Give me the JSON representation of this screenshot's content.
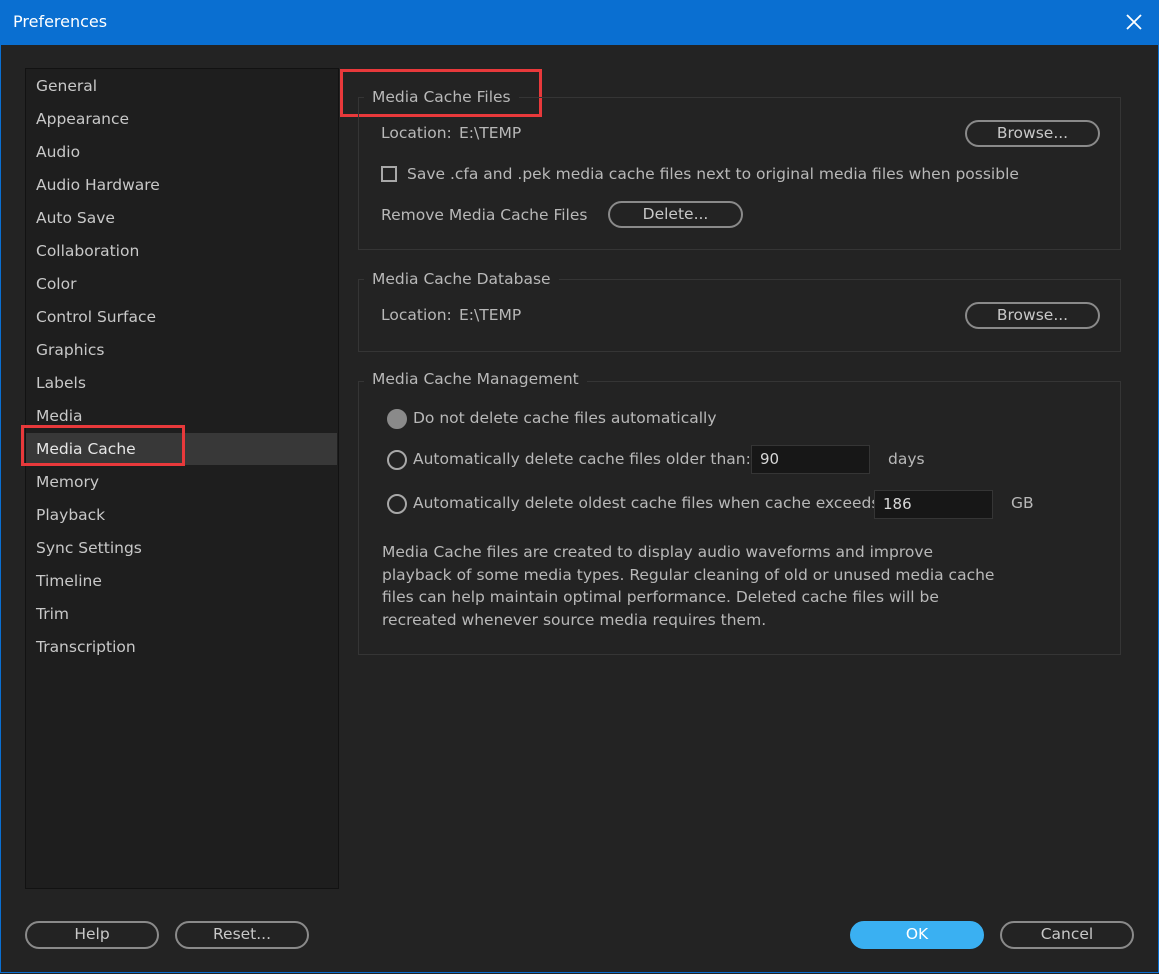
{
  "window": {
    "title": "Preferences"
  },
  "sidebar": {
    "items": [
      {
        "label": "General"
      },
      {
        "label": "Appearance"
      },
      {
        "label": "Audio"
      },
      {
        "label": "Audio Hardware"
      },
      {
        "label": "Auto Save"
      },
      {
        "label": "Collaboration"
      },
      {
        "label": "Color"
      },
      {
        "label": "Control Surface"
      },
      {
        "label": "Graphics"
      },
      {
        "label": "Labels"
      },
      {
        "label": "Media"
      },
      {
        "label": "Media Cache"
      },
      {
        "label": "Memory"
      },
      {
        "label": "Playback"
      },
      {
        "label": "Sync Settings"
      },
      {
        "label": "Timeline"
      },
      {
        "label": "Trim"
      },
      {
        "label": "Transcription"
      }
    ],
    "selected": "Media Cache"
  },
  "files": {
    "legend": "Media Cache Files",
    "location_label": "Location:",
    "location_value": "E:\\TEMP",
    "browse_label": "Browse...",
    "save_checkbox_label": "Save .cfa and .pek media cache files next to original media files when possible",
    "save_checked": false,
    "remove_label": "Remove Media Cache Files",
    "delete_label": "Delete..."
  },
  "database": {
    "legend": "Media Cache Database",
    "location_label": "Location:",
    "location_value": "E:\\TEMP",
    "browse_label": "Browse..."
  },
  "management": {
    "legend": "Media Cache Management",
    "option_none": "Do not delete cache files automatically",
    "option_older": "Automatically delete cache files older than:",
    "older_value": "90",
    "older_unit": "days",
    "option_oldest": "Automatically delete oldest cache files when cache exceeds:",
    "oldest_value": "186",
    "oldest_unit": "GB",
    "selected": "option_none",
    "description": "Media Cache files are created to display audio waveforms and improve playback of some media types.  Regular cleaning of old or unused media cache files can help maintain optimal performance. Deleted cache files will be recreated whenever source media requires them."
  },
  "footer": {
    "help_label": "Help",
    "reset_label": "Reset...",
    "ok_label": "OK",
    "cancel_label": "Cancel"
  },
  "colors": {
    "titlebar": "#0a6fd1",
    "highlight": "#e8393b",
    "primary_button": "#3ab0f2"
  }
}
